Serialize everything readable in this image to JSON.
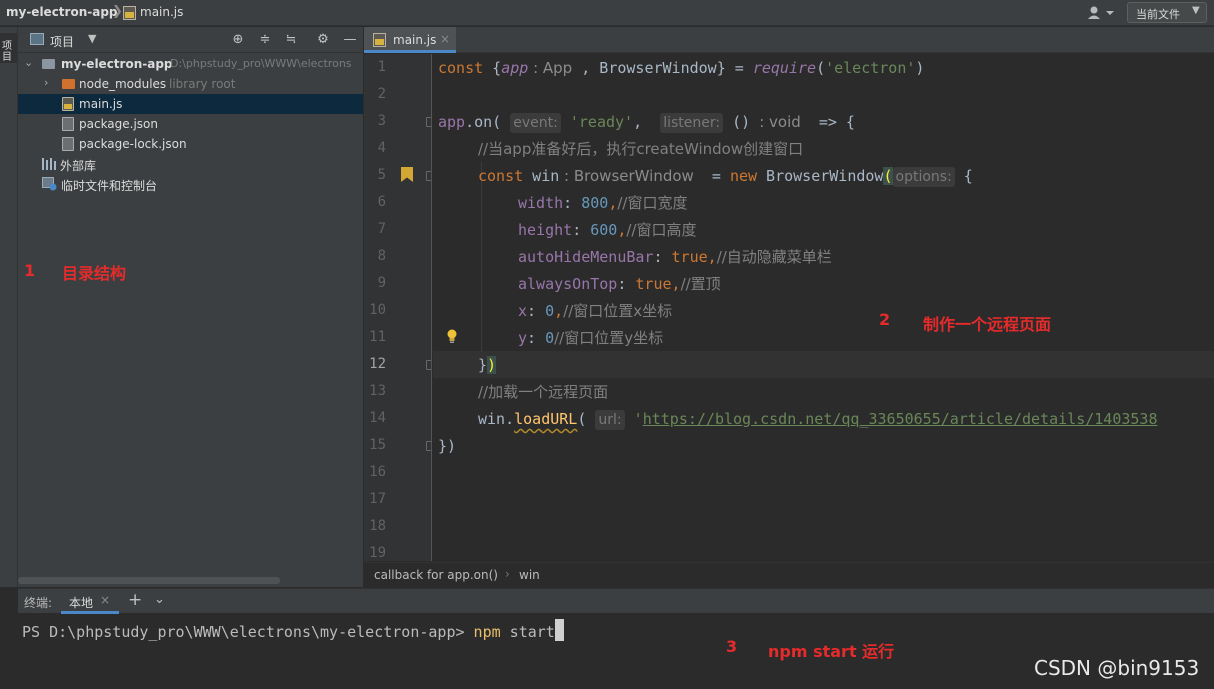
{
  "topbar": {
    "project_name": "my-electron-app",
    "separator": "❯",
    "file_name": "main.js",
    "user_icon": "user-icon",
    "config_selector": "当前文件"
  },
  "left_stripe": {
    "tab_label": "项目"
  },
  "project_panel": {
    "title": "项目",
    "tools": [
      "locate-icon",
      "expand-all-icon",
      "collapse-all-icon",
      "settings-icon",
      "hide-icon"
    ],
    "tree": [
      {
        "label": "my-electron-app",
        "hint": "D:\\phpstudy_pro\\WWW\\electrons",
        "type": "root-folder"
      },
      {
        "label": "node_modules",
        "hint": "library root",
        "type": "folder"
      },
      {
        "label": "main.js",
        "type": "js-file",
        "selected": true
      },
      {
        "label": "package.json",
        "type": "json-file"
      },
      {
        "label": "package-lock.json",
        "type": "json-file"
      },
      {
        "label": "外部库",
        "type": "library"
      },
      {
        "label": "临时文件和控制台",
        "type": "scratch"
      }
    ]
  },
  "editor": {
    "tab": "main.js",
    "line_numbers": [
      "1",
      "2",
      "3",
      "4",
      "5",
      "6",
      "7",
      "8",
      "9",
      "10",
      "11",
      "12",
      "13",
      "14",
      "15",
      "16",
      "17",
      "18",
      "19"
    ],
    "current_line": "12",
    "code": {
      "l1": [
        "const",
        " {",
        "app",
        " : App",
        " , BrowserWindow} = ",
        "require",
        "(",
        "'electron'",
        ")"
      ],
      "l3": [
        "app",
        ".on( ",
        "event:",
        " ",
        "'ready'",
        ",  ",
        "listener:",
        " () ",
        ": void",
        "  => {"
      ],
      "l4": "//当app准备好后，执行createWindow创建窗口",
      "l5": [
        "const",
        " win",
        " : BrowserWindow",
        "  = ",
        "new",
        " BrowserWindow",
        "(",
        "options:",
        " {"
      ],
      "l6": [
        "width",
        ": ",
        "800",
        ",",
        "//窗口宽度"
      ],
      "l7": [
        "height",
        ": ",
        "600",
        ",",
        "//窗口高度"
      ],
      "l8": [
        "autoHideMenuBar",
        ": ",
        "true",
        ",",
        "//自动隐藏菜单栏"
      ],
      "l9": [
        "alwaysOnTop",
        ": ",
        "true",
        ",",
        "//置顶"
      ],
      "l10": [
        "x",
        ": ",
        "0",
        ",",
        "//窗口位置x坐标"
      ],
      "l11": [
        "y",
        ": ",
        "0",
        "//窗口位置y坐标"
      ],
      "l12": [
        "}",
        ")"
      ],
      "l13": "//加载一个远程页面",
      "l14": [
        "win",
        ".",
        "loadURL",
        "( ",
        "url:",
        " '",
        "https://blog.csdn.net/qq_33650655/article/details/1403538"
      ],
      "l15": "})"
    },
    "breadcrumb": [
      "callback for app.on()",
      "win"
    ]
  },
  "terminal": {
    "title": "终端:",
    "tab": "本地",
    "prompt": "PS D:\\phpstudy_pro\\WWW\\electrons\\my-electron-app> ",
    "command": "npm",
    "argument": " start"
  },
  "annotations": {
    "a1_num": "1",
    "a1_text": "目录结构",
    "a2_num": "2",
    "a2_text": "制作一个远程页面",
    "a3_num": "3",
    "a3_text": "npm start 运行"
  },
  "watermark": "CSDN @bin9153",
  "colors": {
    "accent": "#4a88c7",
    "annotation": "#e52b2b",
    "keyword": "#cc7832",
    "string": "#6a8759",
    "number": "#6897bb"
  }
}
